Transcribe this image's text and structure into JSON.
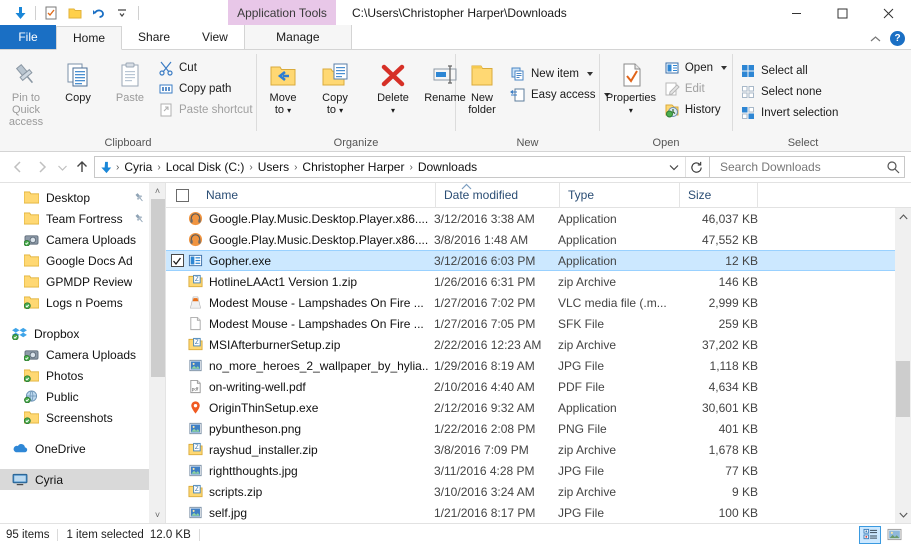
{
  "titlebar": {
    "app_tools_label": "Application Tools",
    "path_title": "C:\\Users\\Christopher Harper\\Downloads",
    "minimize": "—",
    "maximize": "□",
    "close": "✕",
    "qat_icons": [
      "download-arrow-icon",
      "properties-checklist-icon",
      "new-folder-icon",
      "undo-icon",
      "customize-qat-icon"
    ]
  },
  "tabs": {
    "file": "File",
    "items": [
      "Home",
      "Share",
      "View"
    ],
    "manage": "Manage",
    "collapse_ribbon": "^",
    "help": "?"
  },
  "ribbon": {
    "groups": [
      {
        "name": "Clipboard",
        "label": "Clipboard",
        "big_buttons": [
          {
            "label": "Pin to Quick\naccess",
            "line1": "Pin to Quick",
            "line2": "access",
            "icon": "pin-icon",
            "disabled": true
          },
          {
            "label": "Copy",
            "line1": "Copy",
            "line2": "",
            "icon": "copy-icon",
            "disabled": false
          },
          {
            "label": "Paste",
            "line1": "Paste",
            "line2": "",
            "icon": "paste-icon",
            "disabled": true
          }
        ],
        "small_buttons": [
          {
            "label": "Cut",
            "icon": "scissors-icon",
            "disabled": false
          },
          {
            "label": "Copy path",
            "icon": "copy-path-icon",
            "disabled": false
          },
          {
            "label": "Paste shortcut",
            "icon": "paste-shortcut-icon",
            "disabled": true
          }
        ]
      },
      {
        "name": "Organize",
        "label": "Organize",
        "big_buttons": [
          {
            "line1": "Move",
            "line2": "to",
            "icon": "move-to-icon",
            "dropdown": true
          },
          {
            "line1": "Copy",
            "line2": "to",
            "icon": "copy-to-icon",
            "dropdown": true
          },
          {
            "line1": "Delete",
            "line2": "",
            "icon": "delete-x-icon",
            "dropdown": true
          },
          {
            "line1": "Rename",
            "line2": "",
            "icon": "rename-icon",
            "dropdown": false
          }
        ]
      },
      {
        "name": "New",
        "label": "New",
        "big_buttons": [
          {
            "line1": "New",
            "line2": "folder",
            "icon": "new-folder-icon",
            "dropdown": false
          }
        ],
        "small_buttons": [
          {
            "label": "New item",
            "icon": "new-item-icon",
            "dropdown": true
          },
          {
            "label": "Easy access",
            "icon": "easy-access-icon",
            "dropdown": true
          }
        ]
      },
      {
        "name": "Open",
        "label": "Open",
        "big_buttons": [
          {
            "line1": "Properties",
            "line2": "",
            "icon": "properties-icon",
            "dropdown": true
          }
        ],
        "small_buttons": [
          {
            "label": "Open",
            "icon": "open-icon",
            "dropdown": true,
            "disabled": false
          },
          {
            "label": "Edit",
            "icon": "edit-icon",
            "dropdown": false,
            "disabled": true
          },
          {
            "label": "History",
            "icon": "history-icon",
            "dropdown": false,
            "disabled": false
          }
        ]
      },
      {
        "name": "Select",
        "label": "Select",
        "small_buttons": [
          {
            "label": "Select all",
            "icon": "select-all-icon"
          },
          {
            "label": "Select none",
            "icon": "select-none-icon"
          },
          {
            "label": "Invert selection",
            "icon": "invert-selection-icon"
          }
        ]
      }
    ]
  },
  "addressbar": {
    "back": "←",
    "forward": "→",
    "recent": "ˇ",
    "up": "↑",
    "breadcrumbs": [
      "Cyria",
      "Local Disk (C:)",
      "Users",
      "Christopher Harper",
      "Downloads"
    ],
    "dropdown": "ˇ",
    "refresh": "⟳",
    "search_placeholder": "Search Downloads",
    "search_value": ""
  },
  "sidebar": {
    "groups": [
      {
        "items": [
          {
            "label": "Desktop",
            "icon": "folder-icon",
            "pinned": true,
            "indent": 1
          },
          {
            "label": "Team Fortress",
            "icon": "folder-icon",
            "pinned": true,
            "indent": 1
          },
          {
            "label": "Camera Uploads",
            "icon": "camera-icon",
            "pinned": false,
            "indent": 1
          },
          {
            "label": "Google Docs Ad",
            "icon": "folder-icon",
            "pinned": false,
            "indent": 1
          },
          {
            "label": "GPMDP Review",
            "icon": "folder-icon",
            "pinned": false,
            "indent": 1
          },
          {
            "label": "Logs n Poems",
            "icon": "folder-sync-icon",
            "pinned": false,
            "indent": 1
          }
        ]
      },
      {
        "items": [
          {
            "label": "Dropbox",
            "icon": "dropbox-icon",
            "pinned": false,
            "indent": 0
          },
          {
            "label": "Camera Uploads",
            "icon": "camera-icon",
            "pinned": false,
            "indent": 1
          },
          {
            "label": "Photos",
            "icon": "folder-sync-icon",
            "pinned": false,
            "indent": 1
          },
          {
            "label": "Public",
            "icon": "globe-sync-icon",
            "pinned": false,
            "indent": 1
          },
          {
            "label": "Screenshots",
            "icon": "folder-sync-icon",
            "pinned": false,
            "indent": 1
          }
        ]
      },
      {
        "items": [
          {
            "label": "OneDrive",
            "icon": "onedrive-icon",
            "pinned": false,
            "indent": 0
          }
        ]
      },
      {
        "items": [
          {
            "label": "Cyria",
            "icon": "computer-icon",
            "pinned": false,
            "indent": 0,
            "selected": true
          }
        ]
      }
    ],
    "scroll_up": "˄",
    "scroll_down": "˅"
  },
  "filelist": {
    "columns": [
      {
        "key": "name",
        "label": "Name",
        "sorted": true
      },
      {
        "key": "date",
        "label": "Date modified"
      },
      {
        "key": "type",
        "label": "Type"
      },
      {
        "key": "size",
        "label": "Size"
      }
    ],
    "rows": [
      {
        "name": "Google.Play.Music.Desktop.Player.x86....",
        "date": "3/12/2016 3:38 AM",
        "type": "Application",
        "size": "46,037 KB",
        "icon": "gpmdp-icon",
        "selected": false
      },
      {
        "name": "Google.Play.Music.Desktop.Player.x86....",
        "date": "3/8/2016 1:48 AM",
        "type": "Application",
        "size": "47,552 KB",
        "icon": "gpmdp-icon",
        "selected": false
      },
      {
        "name": "Gopher.exe",
        "date": "3/12/2016 6:03 PM",
        "type": "Application",
        "size": "12 KB",
        "icon": "exe-icon",
        "selected": true
      },
      {
        "name": "HotlineLAAct1 Version 1.zip",
        "date": "1/26/2016 6:31 PM",
        "type": "zip Archive",
        "size": "146 KB",
        "icon": "zip-icon",
        "selected": false
      },
      {
        "name": "Modest Mouse - Lampshades On Fire ...",
        "date": "1/27/2016 7:02 PM",
        "type": "VLC media file (.m...",
        "size": "2,999 KB",
        "icon": "vlc-icon",
        "selected": false
      },
      {
        "name": "Modest Mouse - Lampshades On Fire ...",
        "date": "1/27/2016 7:05 PM",
        "type": "SFK File",
        "size": "259 KB",
        "icon": "blank-file-icon",
        "selected": false
      },
      {
        "name": "MSIAfterburnerSetup.zip",
        "date": "2/22/2016 12:23 AM",
        "type": "zip Archive",
        "size": "37,202 KB",
        "icon": "zip-icon",
        "selected": false
      },
      {
        "name": "no_more_heroes_2_wallpaper_by_hylia...",
        "date": "1/29/2016 8:19 AM",
        "type": "JPG File",
        "size": "1,118 KB",
        "icon": "image-icon",
        "selected": false
      },
      {
        "name": "on-writing-well.pdf",
        "date": "2/10/2016 4:40 AM",
        "type": "PDF File",
        "size": "4,634 KB",
        "icon": "pdf-icon",
        "selected": false
      },
      {
        "name": "OriginThinSetup.exe",
        "date": "2/12/2016 9:32 AM",
        "type": "Application",
        "size": "30,601 KB",
        "icon": "origin-icon",
        "selected": false
      },
      {
        "name": "pybuntheson.png",
        "date": "1/22/2016 2:08 PM",
        "type": "PNG File",
        "size": "401 KB",
        "icon": "image-icon",
        "selected": false
      },
      {
        "name": "rayshud_installer.zip",
        "date": "3/8/2016 7:09 PM",
        "type": "zip Archive",
        "size": "1,678 KB",
        "icon": "zip-icon",
        "selected": false
      },
      {
        "name": "rightthoughts.jpg",
        "date": "3/11/2016 4:28 PM",
        "type": "JPG File",
        "size": "77 KB",
        "icon": "image-icon",
        "selected": false
      },
      {
        "name": "scripts.zip",
        "date": "3/10/2016 3:24 AM",
        "type": "zip Archive",
        "size": "9 KB",
        "icon": "zip-icon",
        "selected": false
      },
      {
        "name": "self.jpg",
        "date": "1/21/2016 8:17 PM",
        "type": "JPG File",
        "size": "100 KB",
        "icon": "image-icon",
        "selected": false
      }
    ],
    "scroll_up": "˄",
    "scroll_down": "˅"
  },
  "statusbar": {
    "item_count": "95 items",
    "selection": "1 item selected",
    "selection_size": "12.0 KB",
    "views": [
      {
        "name": "details-view",
        "active": true
      },
      {
        "name": "large-icons-view",
        "active": false
      }
    ]
  },
  "colors": {
    "accent_blue": "#1a6fc4",
    "selection_blue": "#cce8ff",
    "app_tools_pink": "#e8c7e8",
    "folder_yellow": "#ffd966",
    "column_header_text": "#2a4d74"
  }
}
